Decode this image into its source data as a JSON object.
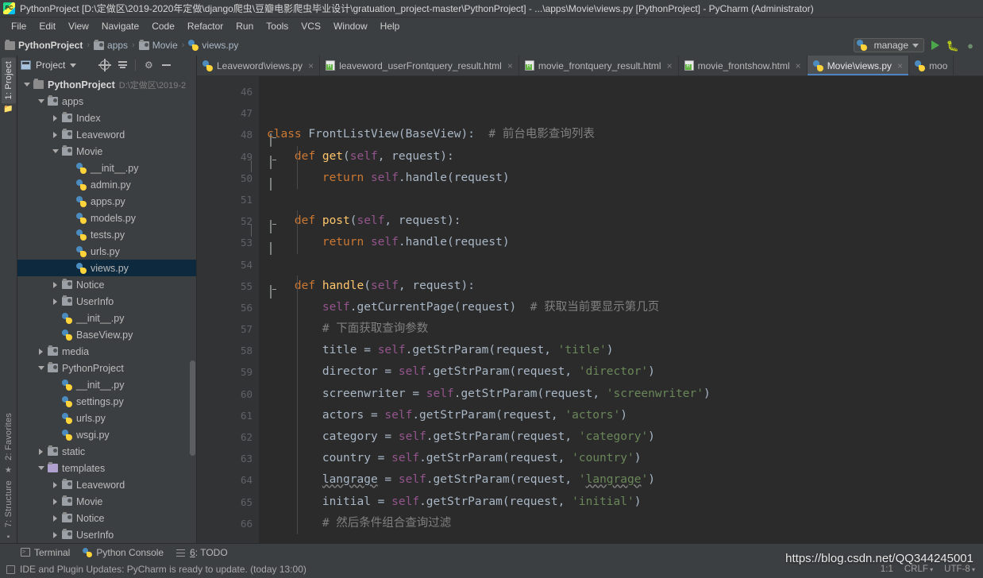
{
  "window": {
    "title": "PythonProject [D:\\定做区\\2019-2020年定做\\django爬虫\\豆瓣电影爬虫毕业设计\\gratuation_project-master\\PythonProject] - ...\\apps\\Movie\\views.py [PythonProject] - PyCharm (Administrator)",
    "logo_text": "PC"
  },
  "menubar": {
    "items": [
      "File",
      "Edit",
      "View",
      "Navigate",
      "Code",
      "Refactor",
      "Run",
      "Tools",
      "VCS",
      "Window",
      "Help"
    ]
  },
  "breadcrumb": {
    "items": [
      {
        "label": "PythonProject",
        "icon": "folder-icon",
        "bold": true
      },
      {
        "label": "apps",
        "icon": "module-folder-icon",
        "bold": false
      },
      {
        "label": "Movie",
        "icon": "module-folder-icon",
        "bold": false
      },
      {
        "label": "views.py",
        "icon": "python-file-icon",
        "bold": false
      }
    ],
    "separator": "›"
  },
  "toolbar": {
    "run_config_label": "manage",
    "run_button_title": "Run",
    "debug_button_title": "Debug",
    "coverage_button_title": "Run with Coverage"
  },
  "project_panel": {
    "header_label": "Project",
    "header_caret": "▼",
    "buttons": [
      "locate-icon",
      "collapse-all-icon",
      "settings-icon",
      "hide-icon"
    ],
    "tree": [
      {
        "depth": 0,
        "arrow": "down",
        "icon": "folder-icon",
        "label": "PythonProject",
        "bold": true,
        "path": "D:\\定做区\\2019-2",
        "selected": false
      },
      {
        "depth": 1,
        "arrow": "down",
        "icon": "module-folder-icon",
        "label": "apps",
        "bold": false,
        "path": "",
        "selected": false
      },
      {
        "depth": 2,
        "arrow": "right",
        "icon": "module-folder-icon",
        "label": "Index",
        "bold": false,
        "path": "",
        "selected": false
      },
      {
        "depth": 2,
        "arrow": "right",
        "icon": "module-folder-icon",
        "label": "Leaveword",
        "bold": false,
        "path": "",
        "selected": false
      },
      {
        "depth": 2,
        "arrow": "down",
        "icon": "module-folder-icon",
        "label": "Movie",
        "bold": false,
        "path": "",
        "selected": false
      },
      {
        "depth": 3,
        "arrow": "none",
        "icon": "python-file-icon",
        "label": "__init__.py",
        "bold": false,
        "path": "",
        "selected": false
      },
      {
        "depth": 3,
        "arrow": "none",
        "icon": "python-file-icon",
        "label": "admin.py",
        "bold": false,
        "path": "",
        "selected": false
      },
      {
        "depth": 3,
        "arrow": "none",
        "icon": "python-file-icon",
        "label": "apps.py",
        "bold": false,
        "path": "",
        "selected": false
      },
      {
        "depth": 3,
        "arrow": "none",
        "icon": "python-file-icon",
        "label": "models.py",
        "bold": false,
        "path": "",
        "selected": false
      },
      {
        "depth": 3,
        "arrow": "none",
        "icon": "python-file-icon",
        "label": "tests.py",
        "bold": false,
        "path": "",
        "selected": false
      },
      {
        "depth": 3,
        "arrow": "none",
        "icon": "python-file-icon",
        "label": "urls.py",
        "bold": false,
        "path": "",
        "selected": false
      },
      {
        "depth": 3,
        "arrow": "none",
        "icon": "python-file-icon",
        "label": "views.py",
        "bold": false,
        "path": "",
        "selected": true
      },
      {
        "depth": 2,
        "arrow": "right",
        "icon": "module-folder-icon",
        "label": "Notice",
        "bold": false,
        "path": "",
        "selected": false
      },
      {
        "depth": 2,
        "arrow": "right",
        "icon": "module-folder-icon",
        "label": "UserInfo",
        "bold": false,
        "path": "",
        "selected": false
      },
      {
        "depth": 2,
        "arrow": "none",
        "icon": "python-file-icon",
        "label": "__init__.py",
        "bold": false,
        "path": "",
        "selected": false
      },
      {
        "depth": 2,
        "arrow": "none",
        "icon": "python-file-icon",
        "label": "BaseView.py",
        "bold": false,
        "path": "",
        "selected": false
      },
      {
        "depth": 1,
        "arrow": "right",
        "icon": "module-folder-icon",
        "label": "media",
        "bold": false,
        "path": "",
        "selected": false
      },
      {
        "depth": 1,
        "arrow": "down",
        "icon": "module-folder-icon",
        "label": "PythonProject",
        "bold": false,
        "path": "",
        "selected": false
      },
      {
        "depth": 2,
        "arrow": "none",
        "icon": "python-file-icon",
        "label": "__init__.py",
        "bold": false,
        "path": "",
        "selected": false
      },
      {
        "depth": 2,
        "arrow": "none",
        "icon": "python-file-icon",
        "label": "settings.py",
        "bold": false,
        "path": "",
        "selected": false
      },
      {
        "depth": 2,
        "arrow": "none",
        "icon": "python-file-icon",
        "label": "urls.py",
        "bold": false,
        "path": "",
        "selected": false
      },
      {
        "depth": 2,
        "arrow": "none",
        "icon": "python-file-icon",
        "label": "wsgi.py",
        "bold": false,
        "path": "",
        "selected": false
      },
      {
        "depth": 1,
        "arrow": "right",
        "icon": "module-folder-icon",
        "label": "static",
        "bold": false,
        "path": "",
        "selected": false
      },
      {
        "depth": 1,
        "arrow": "down",
        "icon": "templates-folder-icon",
        "label": "templates",
        "bold": false,
        "path": "",
        "selected": false
      },
      {
        "depth": 2,
        "arrow": "right",
        "icon": "module-folder-icon",
        "label": "Leaveword",
        "bold": false,
        "path": "",
        "selected": false
      },
      {
        "depth": 2,
        "arrow": "right",
        "icon": "module-folder-icon",
        "label": "Movie",
        "bold": false,
        "path": "",
        "selected": false
      },
      {
        "depth": 2,
        "arrow": "right",
        "icon": "module-folder-icon",
        "label": "Notice",
        "bold": false,
        "path": "",
        "selected": false
      },
      {
        "depth": 2,
        "arrow": "right",
        "icon": "module-folder-icon",
        "label": "UserInfo",
        "bold": false,
        "path": "",
        "selected": false
      }
    ]
  },
  "left_strip": {
    "top": [
      "1: Project"
    ],
    "bottom": [
      "2: Favorites",
      "7: Structure"
    ]
  },
  "editor_tabs": [
    {
      "label": "Leaveword\\views.py",
      "icon": "python-file-icon",
      "active": false,
      "closable": true
    },
    {
      "label": "leaveword_userFrontquery_result.html",
      "icon": "html-file-icon",
      "active": false,
      "closable": true
    },
    {
      "label": "movie_frontquery_result.html",
      "icon": "html-file-icon",
      "active": false,
      "closable": true
    },
    {
      "label": "movie_frontshow.html",
      "icon": "html-file-icon",
      "active": false,
      "closable": true
    },
    {
      "label": "Movie\\views.py",
      "icon": "python-file-icon",
      "active": true,
      "closable": true
    },
    {
      "label": "moo",
      "icon": "python-file-icon",
      "active": false,
      "closable": false
    }
  ],
  "code": {
    "first_line_number": 46,
    "lines": [
      {
        "n": 46,
        "fold": "none",
        "tokens": []
      },
      {
        "n": 47,
        "fold": "none",
        "tokens": []
      },
      {
        "n": 48,
        "fold": "class",
        "tokens": [
          {
            "t": "class ",
            "c": "kw"
          },
          {
            "t": "FrontListView",
            "c": "cls"
          },
          {
            "t": "(",
            "c": "id"
          },
          {
            "t": "BaseView",
            "c": "id"
          },
          {
            "t": "):  ",
            "c": "id"
          },
          {
            "t": "# 前台电影查询列表",
            "c": "cmt"
          }
        ]
      },
      {
        "n": 49,
        "fold": "def",
        "tokens": [
          {
            "t": "    ",
            "c": "id"
          },
          {
            "t": "def ",
            "c": "kw"
          },
          {
            "t": "get",
            "c": "fn"
          },
          {
            "t": "(",
            "c": "id"
          },
          {
            "t": "self",
            "c": "self"
          },
          {
            "t": ", request):",
            "c": "id"
          }
        ]
      },
      {
        "n": 50,
        "fold": "end",
        "tokens": [
          {
            "t": "        ",
            "c": "id"
          },
          {
            "t": "return ",
            "c": "kw"
          },
          {
            "t": "self",
            "c": "self"
          },
          {
            "t": ".handle(request)",
            "c": "id"
          }
        ]
      },
      {
        "n": 51,
        "fold": "none",
        "tokens": []
      },
      {
        "n": 52,
        "fold": "def",
        "tokens": [
          {
            "t": "    ",
            "c": "id"
          },
          {
            "t": "def ",
            "c": "kw"
          },
          {
            "t": "post",
            "c": "fn"
          },
          {
            "t": "(",
            "c": "id"
          },
          {
            "t": "self",
            "c": "self"
          },
          {
            "t": ", request):",
            "c": "id"
          }
        ]
      },
      {
        "n": 53,
        "fold": "end",
        "tokens": [
          {
            "t": "        ",
            "c": "id"
          },
          {
            "t": "return ",
            "c": "kw"
          },
          {
            "t": "self",
            "c": "self"
          },
          {
            "t": ".handle(request)",
            "c": "id"
          }
        ]
      },
      {
        "n": 54,
        "fold": "none",
        "tokens": []
      },
      {
        "n": 55,
        "fold": "def",
        "tokens": [
          {
            "t": "    ",
            "c": "id"
          },
          {
            "t": "def ",
            "c": "kw"
          },
          {
            "t": "handle",
            "c": "fn"
          },
          {
            "t": "(",
            "c": "id"
          },
          {
            "t": "self",
            "c": "self"
          },
          {
            "t": ", request):",
            "c": "id"
          }
        ]
      },
      {
        "n": 56,
        "fold": "none",
        "tokens": [
          {
            "t": "        ",
            "c": "id"
          },
          {
            "t": "self",
            "c": "self"
          },
          {
            "t": ".getCurrentPage(request)  ",
            "c": "id"
          },
          {
            "t": "# 获取当前要显示第几页",
            "c": "cmt"
          }
        ]
      },
      {
        "n": 57,
        "fold": "none",
        "tokens": [
          {
            "t": "        ",
            "c": "id"
          },
          {
            "t": "# 下面获取查询参数",
            "c": "cmt"
          }
        ]
      },
      {
        "n": 58,
        "fold": "none",
        "tokens": [
          {
            "t": "        title = ",
            "c": "id"
          },
          {
            "t": "self",
            "c": "self"
          },
          {
            "t": ".getStrParam(request, ",
            "c": "id"
          },
          {
            "t": "'title'",
            "c": "str"
          },
          {
            "t": ")",
            "c": "id"
          }
        ]
      },
      {
        "n": 59,
        "fold": "none",
        "tokens": [
          {
            "t": "        director = ",
            "c": "id"
          },
          {
            "t": "self",
            "c": "self"
          },
          {
            "t": ".getStrParam(request, ",
            "c": "id"
          },
          {
            "t": "'director'",
            "c": "str"
          },
          {
            "t": ")",
            "c": "id"
          }
        ]
      },
      {
        "n": 60,
        "fold": "none",
        "tokens": [
          {
            "t": "        screenwriter = ",
            "c": "id"
          },
          {
            "t": "self",
            "c": "self"
          },
          {
            "t": ".getStrParam(request, ",
            "c": "id"
          },
          {
            "t": "'screenwriter'",
            "c": "str"
          },
          {
            "t": ")",
            "c": "id"
          }
        ]
      },
      {
        "n": 61,
        "fold": "none",
        "tokens": [
          {
            "t": "        actors = ",
            "c": "id"
          },
          {
            "t": "self",
            "c": "self"
          },
          {
            "t": ".getStrParam(request, ",
            "c": "id"
          },
          {
            "t": "'actors'",
            "c": "str"
          },
          {
            "t": ")",
            "c": "id"
          }
        ]
      },
      {
        "n": 62,
        "fold": "none",
        "tokens": [
          {
            "t": "        category = ",
            "c": "id"
          },
          {
            "t": "self",
            "c": "self"
          },
          {
            "t": ".getStrParam(request, ",
            "c": "id"
          },
          {
            "t": "'category'",
            "c": "str"
          },
          {
            "t": ")",
            "c": "id"
          }
        ]
      },
      {
        "n": 63,
        "fold": "none",
        "tokens": [
          {
            "t": "        country = ",
            "c": "id"
          },
          {
            "t": "self",
            "c": "self"
          },
          {
            "t": ".getStrParam(request, ",
            "c": "id"
          },
          {
            "t": "'country'",
            "c": "str"
          },
          {
            "t": ")",
            "c": "id"
          }
        ]
      },
      {
        "n": 64,
        "fold": "none",
        "tokens": [
          {
            "t": "        ",
            "c": "id"
          },
          {
            "t": "langrage",
            "c": "id",
            "typo": true
          },
          {
            "t": " = ",
            "c": "id"
          },
          {
            "t": "self",
            "c": "self"
          },
          {
            "t": ".getStrParam(request, ",
            "c": "id"
          },
          {
            "t": "'",
            "c": "str"
          },
          {
            "t": "langrage",
            "c": "str",
            "typo": true
          },
          {
            "t": "'",
            "c": "str"
          },
          {
            "t": ")",
            "c": "id"
          }
        ]
      },
      {
        "n": 65,
        "fold": "none",
        "tokens": [
          {
            "t": "        initial = ",
            "c": "id"
          },
          {
            "t": "self",
            "c": "self"
          },
          {
            "t": ".getStrParam(request, ",
            "c": "id"
          },
          {
            "t": "'initial'",
            "c": "str"
          },
          {
            "t": ")",
            "c": "id"
          }
        ]
      },
      {
        "n": 66,
        "fold": "none",
        "tokens": [
          {
            "t": "        ",
            "c": "id"
          },
          {
            "t": "# 然后条件组合查询过滤",
            "c": "cmt"
          }
        ]
      }
    ]
  },
  "bottom_bar": {
    "items": [
      {
        "label": "Terminal",
        "icon": "terminal-icon"
      },
      {
        "label": "Python Console",
        "icon": "python-console-icon"
      },
      {
        "label": "6: TODO",
        "icon": "todo-icon"
      }
    ]
  },
  "status_bar": {
    "message": "IDE and Plugin Updates: PyCharm is ready to update. (today 13:00)",
    "caret_position": "1:1",
    "line_separator": "CRLF",
    "encoding": "UTF-8"
  },
  "watermark": {
    "text": "https://blog.csdn.net/QQ344245001"
  },
  "colors": {
    "background": "#3c3f41",
    "editor_background": "#2b2b2b",
    "gutter_background": "#313335",
    "selection": "#0d293e",
    "keyword": "#cc7832",
    "function": "#ffc66d",
    "string": "#6a8759",
    "comment": "#808080",
    "self": "#94558d",
    "default_text": "#a9b7c6",
    "tab_active": "#4e5254",
    "tab_underline": "#4f84c4"
  }
}
